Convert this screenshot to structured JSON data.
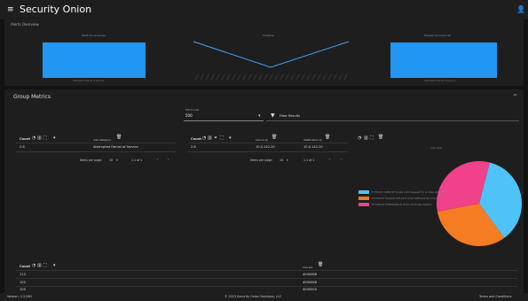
{
  "app": {
    "brand": "Security Onion"
  },
  "top_panel": {
    "title": "Alerts Overview",
    "charts": [
      {
        "title": "Most Occurrences",
        "bar_label": "Attempted Denial of Service"
      },
      {
        "title": "Timeline"
      },
      {
        "title": "Fewest Occurrences",
        "bar_label": "Attempted Denial of Service"
      }
    ],
    "y_ticks": [
      "500",
      "400",
      "300",
      "200",
      "100",
      "0"
    ]
  },
  "group_metrics": {
    "title": "Group Metrics",
    "field_label": "Fetch Limit",
    "fetch_limit": "500",
    "filter_label": "Filter Results"
  },
  "table1": {
    "count_header": "Count",
    "col_header": "rule.category",
    "rows": [
      {
        "count": "2.8",
        "value": "Attempted Denial of Service"
      }
    ],
    "rows_per_page_label": "Items per page:",
    "rows_per_page": "10",
    "range": "1-1 of 1"
  },
  "table2": {
    "count_header": "Count",
    "col1_header": "source.ip",
    "col2_header": "destination.ip",
    "rows": [
      {
        "count": "2.8",
        "source": "10.0.142.20",
        "destination": "10.0.142.20"
      }
    ],
    "rows_per_page_label": "Items per page:",
    "rows_per_page": "10",
    "range": "1-1 of 1"
  },
  "pie": {
    "title": "rule.name",
    "slices": [
      {
        "label": "ET POLICY SMB2 NT Create AndX Request For an Executable File",
        "value": 36,
        "color": "#4fc3f7"
      },
      {
        "label": "ET EXPLOIT Possible CVE-2017-0144 SMB Remote Code Exec",
        "value": 32,
        "color": "#f57c22"
      },
      {
        "label": "ET EXPLOIT ETERNALBLUE Probe Vulnerable System",
        "value": 32,
        "color": "#f0418a"
      }
    ]
  },
  "table3": {
    "count_header": "Count",
    "col_header": "rule.sid",
    "rows": [
      {
        "count": "113",
        "value": "4000066"
      },
      {
        "count": "100",
        "value": "4000068"
      },
      {
        "count": "100",
        "value": "4000050"
      }
    ]
  },
  "footer": {
    "version": "Version: 2.3.260",
    "copyright": "© 2023 Security Onion Solutions, LLC",
    "terms": "Terms and Conditions"
  }
}
